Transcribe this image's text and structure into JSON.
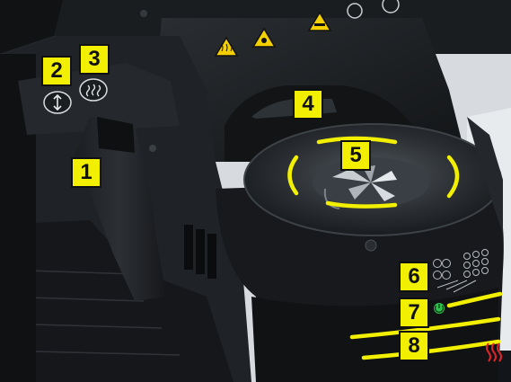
{
  "callouts": [
    {
      "number": "1",
      "target": "lever"
    },
    {
      "number": "2",
      "target": "lift-button"
    },
    {
      "number": "3",
      "target": "heat-button"
    },
    {
      "number": "4",
      "target": "front-opening"
    },
    {
      "number": "5",
      "target": "iris-fan-disc"
    },
    {
      "number": "6",
      "target": "led-indicator-panel"
    },
    {
      "number": "7",
      "target": "power-indicator"
    },
    {
      "number": "8",
      "target": "heating-zone-stripes"
    }
  ],
  "icons": {
    "button_2": "up-down-arrows-icon",
    "button_3": "heat-waves-icon",
    "status_light": "green-power-icon",
    "corner": "heat-warning-icon",
    "warning_labels": [
      "hot-surface-warning-icon",
      "pinch-hazard-warning-icon",
      "hand-crush-warning-icon"
    ]
  },
  "colors": {
    "highlight": "#f2f000",
    "machine_body": "#1c1f22",
    "background": "#d7dbe0",
    "status_green": "#2ec24b",
    "warning_red": "#e0242b"
  }
}
